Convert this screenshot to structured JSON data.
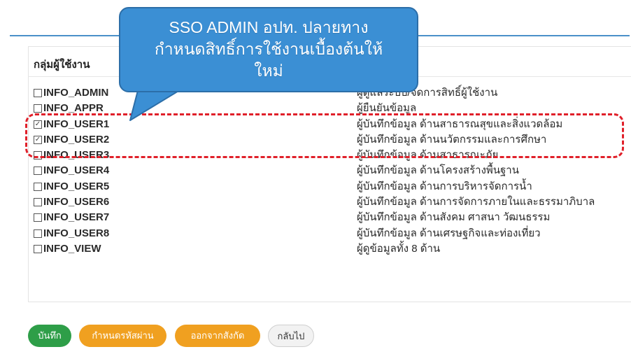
{
  "group_heading": "กลุ่มผู้ใช้งาน",
  "callout": {
    "line1": "SSO ADMIN อปท. ปลายทาง",
    "line2": "กำหนดสิทธิ์การใช้งานเบื้องต้นให้",
    "line3": "ใหม่"
  },
  "roles": [
    {
      "code": "INFO_ADMIN",
      "desc": "ผู้ดูแลระบบ/จัดการสิทธิ์ผู้ใช้งาน",
      "checked": false
    },
    {
      "code": "INFO_APPR",
      "desc": "ผู้ยืนยันข้อมูล",
      "checked": false
    },
    {
      "code": "INFO_USER1",
      "desc": "ผู้บันทึกข้อมูล ด้านสาธารณสุขและสิ่งแวดล้อม",
      "checked": true
    },
    {
      "code": "INFO_USER2",
      "desc": "ผู้บันทึกข้อมูล ด้านนวัตกรรมและการศึกษา",
      "checked": true
    },
    {
      "code": "INFO_USER3",
      "desc": "ผู้บันทึกข้อมูล ด้านสาธารณะภัย",
      "checked": false
    },
    {
      "code": "INFO_USER4",
      "desc": "ผู้บันทึกข้อมูล ด้านโครงสร้างพื้นฐาน",
      "checked": false
    },
    {
      "code": "INFO_USER5",
      "desc": "ผู้บันทึกข้อมูล ด้านการบริหารจัดการน้ำ",
      "checked": false
    },
    {
      "code": "INFO_USER6",
      "desc": "ผู้บันทึกข้อมูล ด้านการจัดการภายในและธรรมาภิบาล",
      "checked": false
    },
    {
      "code": "INFO_USER7",
      "desc": "ผู้บันทึกข้อมูล ด้านสังคม ศาสนา วัฒนธรรม",
      "checked": false
    },
    {
      "code": "INFO_USER8",
      "desc": "ผู้บันทึกข้อมูล ด้านเศรษฐกิจและท่องเที่ยว",
      "checked": false
    },
    {
      "code": "INFO_VIEW",
      "desc": "ผู้ดูข้อมูลทั้ง 8 ด้าน",
      "checked": false
    }
  ],
  "buttons": {
    "save": "บันทึก",
    "set_password": "กำหนดรหัสผ่าน",
    "leave_agency": "ออกจากสังกัด",
    "back": "กลับไป"
  },
  "colors": {
    "accent_blue": "#3b8fd4",
    "highlight_red": "#e0202a",
    "save_green": "#2e9e48",
    "action_orange": "#f0a020"
  }
}
